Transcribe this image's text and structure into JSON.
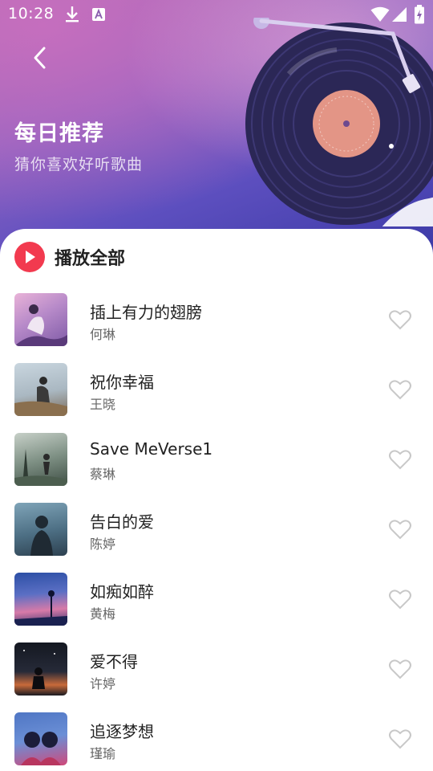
{
  "status_bar": {
    "time": "10:28",
    "icons": [
      "download-icon",
      "a-notification-icon",
      "wifi-icon",
      "signal-icon",
      "battery-icon"
    ]
  },
  "header": {
    "title": "每日推荐",
    "subtitle": "猜你喜欢好听歌曲"
  },
  "actions": {
    "play_all_label": "播放全部"
  },
  "songs": [
    {
      "title": "插上有力的翅膀",
      "artist": "何琳"
    },
    {
      "title": "祝你幸福",
      "artist": "王晓"
    },
    {
      "title": "Save  MeVerse1",
      "artist": "蔡琳"
    },
    {
      "title": "告白的爱",
      "artist": "陈婷"
    },
    {
      "title": "如痴如醉",
      "artist": "黄梅"
    },
    {
      "title": "爱不得",
      "artist": "许婷"
    },
    {
      "title": "追逐梦想",
      "artist": "瑾瑜"
    }
  ],
  "colors": {
    "accent": "#f23a4f",
    "hero_gradient": [
      "#b46fb6",
      "#8f63c3",
      "#5d4fbf",
      "#3b3aa6"
    ],
    "record_label": "#e39586"
  }
}
